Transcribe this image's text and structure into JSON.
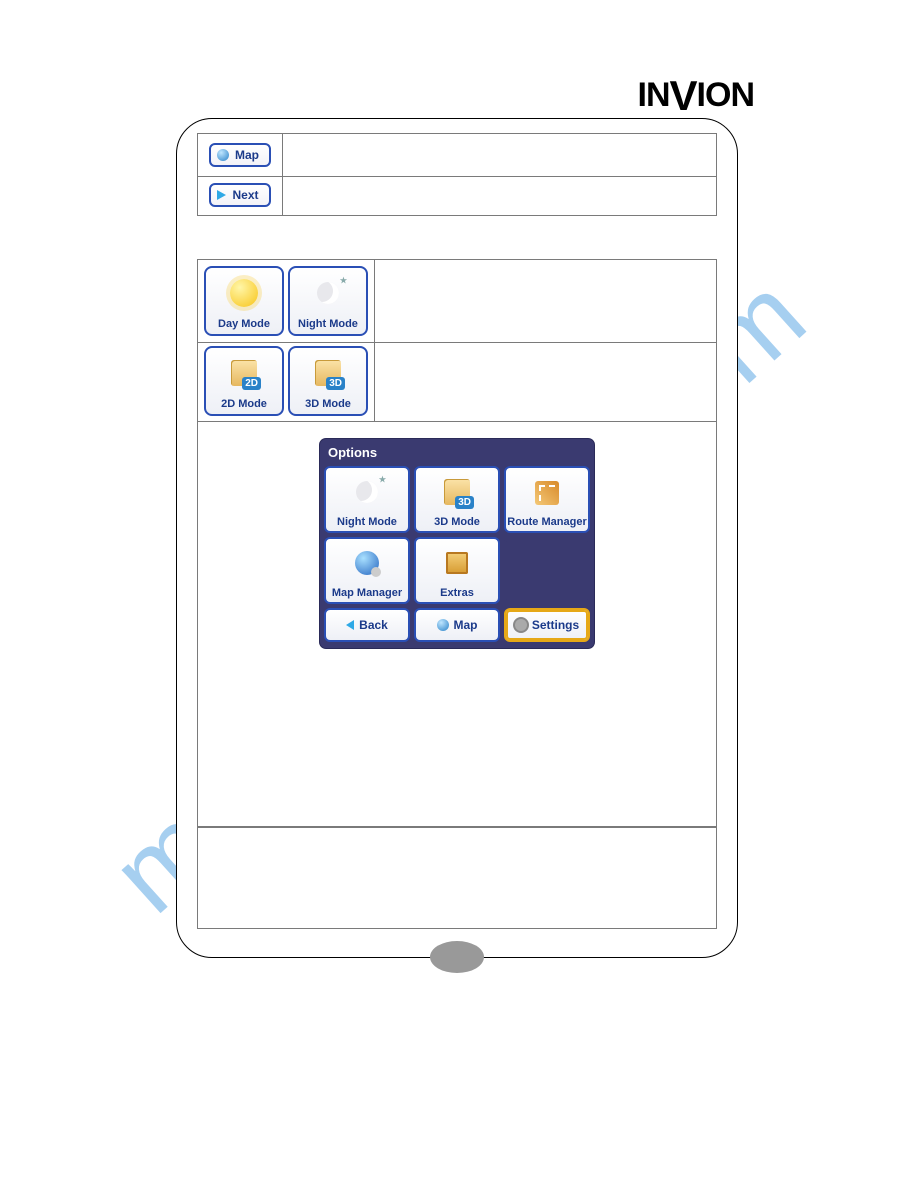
{
  "brand": {
    "text": "INVION"
  },
  "watermark": "manualshive.com",
  "header_buttons": {
    "map": {
      "label": "Map"
    },
    "next": {
      "label": "Next"
    }
  },
  "mode_buttons": {
    "day": {
      "label": "Day Mode"
    },
    "night": {
      "label": "Night Mode"
    },
    "m2d": {
      "label": "2D Mode",
      "badge": "2D"
    },
    "m3d": {
      "label": "3D Mode",
      "badge": "3D"
    }
  },
  "options_panel": {
    "title": "Options",
    "items": {
      "night": {
        "label": "Night Mode"
      },
      "m3d": {
        "label": "3D Mode",
        "badge": "3D"
      },
      "route": {
        "label": "Route Manager"
      },
      "mapmgr": {
        "label": "Map Manager"
      },
      "extras": {
        "label": "Extras"
      }
    },
    "footer": {
      "back": {
        "label": "Back"
      },
      "map": {
        "label": "Map"
      },
      "settings": {
        "label": "Settings"
      }
    }
  }
}
